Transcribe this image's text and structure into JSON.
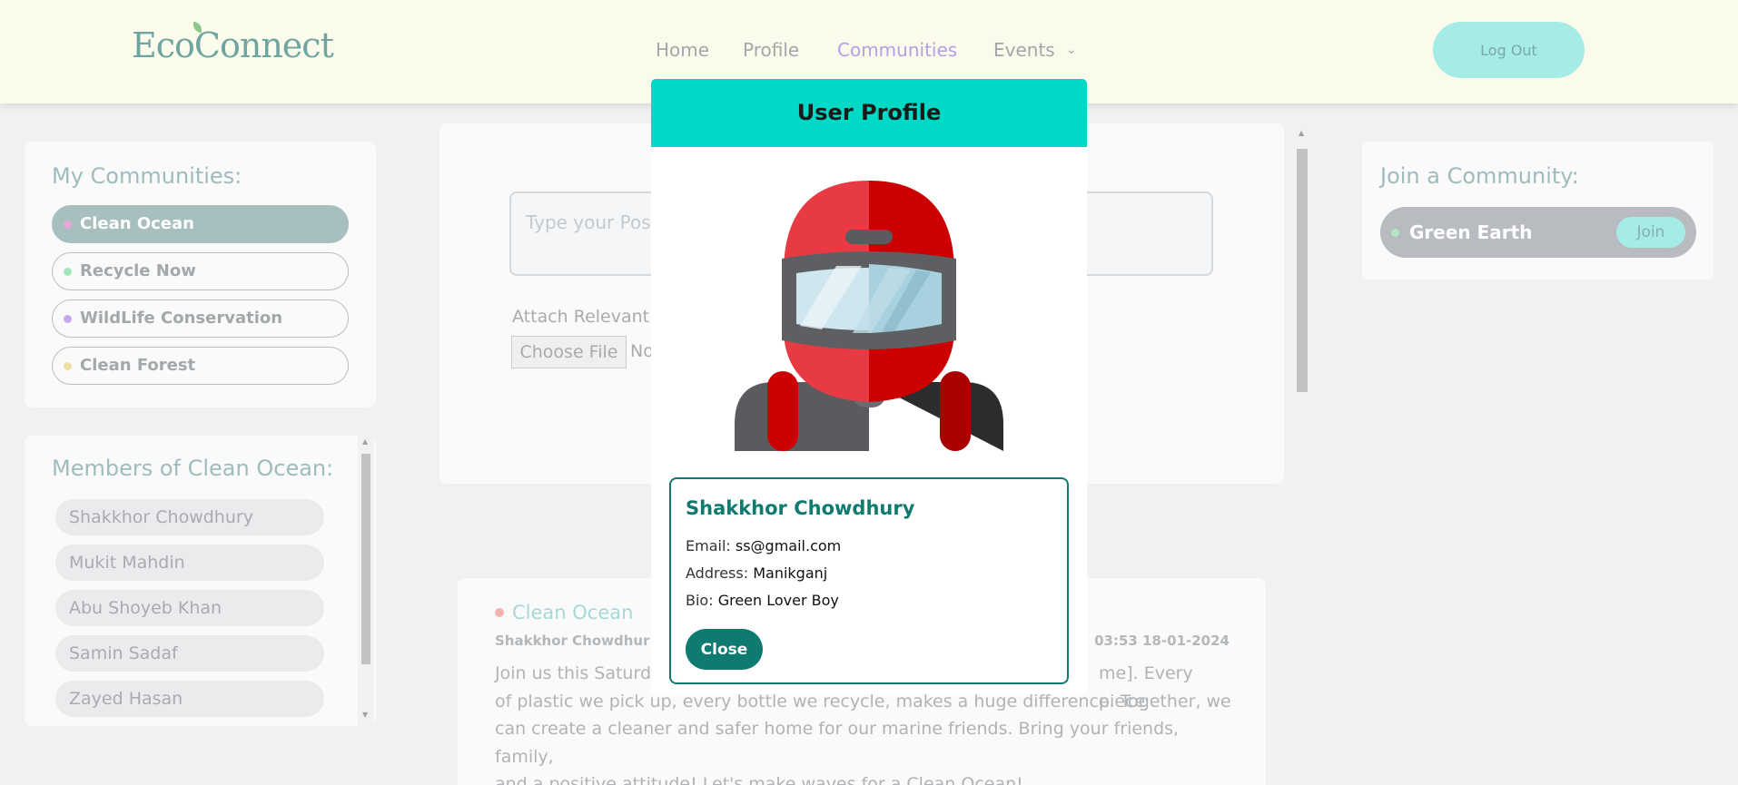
{
  "header": {
    "logo": "EcoConnect",
    "nav": [
      {
        "label": "Home"
      },
      {
        "label": "Profile"
      },
      {
        "label": "Communities"
      },
      {
        "label": "Events"
      }
    ],
    "logout_label": "Log Out"
  },
  "my_communities": {
    "title": "My Communities:",
    "items": [
      {
        "label": "Clean Ocean",
        "dot": "#e6a7dc",
        "active": true
      },
      {
        "label": "Recycle Now",
        "dot": "#a3e6bb",
        "active": false
      },
      {
        "label": "WildLife Conservation",
        "dot": "#c9a7ec",
        "active": false
      },
      {
        "label": "Clean Forest",
        "dot": "#ede0a1",
        "active": false
      }
    ]
  },
  "members": {
    "title": "Members of Clean Ocean:",
    "items": [
      "Shakkhor Chowdhury",
      "Mukit Mahdin",
      "Abu Shoyeb Khan",
      "Samin Sadaf",
      "Zayed Hasan"
    ]
  },
  "composer": {
    "placeholder": "Type your Post",
    "attach_label": "Attach Relevant",
    "choose_file": "Choose File",
    "no_file": "No"
  },
  "post": {
    "community": "Clean Ocean",
    "author": "Shakkhor Chowdhur",
    "time": "03:53 18-01-2024",
    "body_line1_start": "Join us this Saturd",
    "body_line1_end": "me]. Every piece",
    "body_line2": "of plastic we pick up, every bottle we recycle, makes a huge difference. Together, we",
    "body_line3": "can create a cleaner and safer home for our marine friends. Bring your friends, family,",
    "body_line4": "and a positive attitude! Let's make waves for a Clean Ocean!"
  },
  "join_community": {
    "title": "Join a Community:",
    "items": [
      {
        "label": "Green Earth",
        "dot": "#b3e8c4",
        "button": "Join"
      }
    ]
  },
  "modal": {
    "title": "User Profile",
    "name": "Shakkhor Chowdhury",
    "email_label": "Email:",
    "email": "ss@gmail.com",
    "address_label": "Address:",
    "address": "Manikganj",
    "bio_label": "Bio:",
    "bio": "Green Lover Boy",
    "close_label": "Close"
  },
  "colors": {
    "accent_teal": "#00d9c5",
    "dark_teal": "#0f7a70",
    "header_bg": "#fbfbec",
    "active_nav": "#b79ee3"
  }
}
